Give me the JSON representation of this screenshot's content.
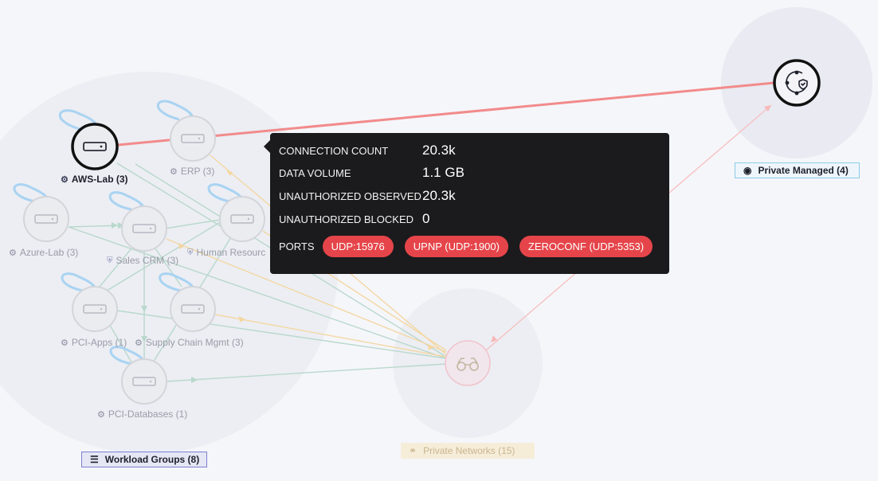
{
  "nodes": {
    "aws_lab": "AWS-Lab (3)",
    "erp": "ERP (3)",
    "azure_lab": "Azure-Lab (3)",
    "sales_crm": "Sales CRM (3)",
    "human_resources": "Human Resourc",
    "pci_apps": "PCI-Apps (1)",
    "supply_chain": "Supply Chain Mgmt (3)",
    "pci_databases": "PCI-Databases (1)"
  },
  "groups": {
    "workload_groups": "Workload Groups (8)",
    "private_networks": "Private Networks (15)",
    "private_managed": "Private Managed (4)"
  },
  "tooltip": {
    "connection_count_label": "CONNECTION COUNT",
    "connection_count": "20.3k",
    "data_volume_label": "DATA VOLUME",
    "data_volume": "1.1 GB",
    "unauthorized_observed_label": "UNAUTHORIZED OBSERVED",
    "unauthorized_observed": "20.3k",
    "unauthorized_blocked_label": "UNAUTHORIZED BLOCKED",
    "unauthorized_blocked": "0",
    "ports_label": "PORTS",
    "ports": [
      "UDP:15976",
      "UPNP (UDP:1900)",
      "ZEROCONF (UDP:5353)"
    ]
  },
  "colors": {
    "highlight_edge": "#f28b8b",
    "port_pill": "#e5454a",
    "allowed_edge": "#b9d8cc",
    "warning_edge": "#f4d7a2",
    "self_loop": "#a9d3f2"
  },
  "icons": {
    "workload": "server-icon",
    "group_workload": "list-icon",
    "group_private_networks": "binoculars-icon",
    "group_private_managed": "globe-shield-icon"
  }
}
